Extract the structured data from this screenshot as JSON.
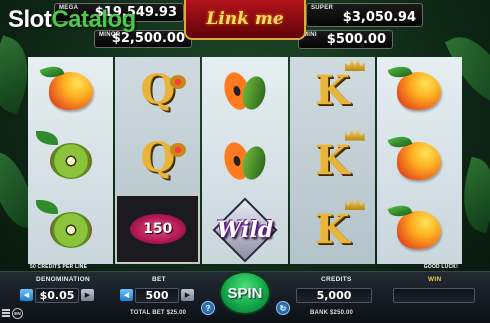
{
  "watermark": {
    "part1": "Slot",
    "part2": "Catalog"
  },
  "logo": {
    "text": "Link me"
  },
  "jackpots": {
    "mega": {
      "label": "MEGA",
      "value": "$19,549.93"
    },
    "minor": {
      "label": "MINOR",
      "value": "$2,500.00"
    },
    "super": {
      "label": "SUPER",
      "value": "$3,050.94"
    },
    "mini": {
      "label": "MINI",
      "value": "$500.00"
    }
  },
  "reels": [
    [
      "mango",
      "kiwi",
      "kiwi"
    ],
    [
      "queen",
      "queen",
      "lips"
    ],
    [
      "papaya",
      "papaya",
      "wild"
    ],
    [
      "king",
      "king",
      "king"
    ],
    [
      "mango",
      "mango",
      "mango"
    ]
  ],
  "lips_value": "150",
  "wild_label": "Wild",
  "letters": {
    "queen": "Q",
    "king": "K"
  },
  "info": {
    "lines": "50 CREDITS PER LINE",
    "luck": "GOOD LUCK!"
  },
  "controls": {
    "denomination_label": "DENOMINATION",
    "denomination_value": "$0.05",
    "bet_label": "BET",
    "bet_value": "500",
    "total_bet": "TOTAL BET $25.00",
    "spin_label": "SPIN",
    "help_label": "?",
    "credits_label": "CREDITS",
    "credits_value": "5,000",
    "bank": "BANK $250.00",
    "win_label": "WIN",
    "win_value": "",
    "lang": "EN"
  },
  "colors": {
    "accent_green": "#15a74a",
    "gold": "#e9b43a",
    "logo_red": "#b3131b"
  }
}
